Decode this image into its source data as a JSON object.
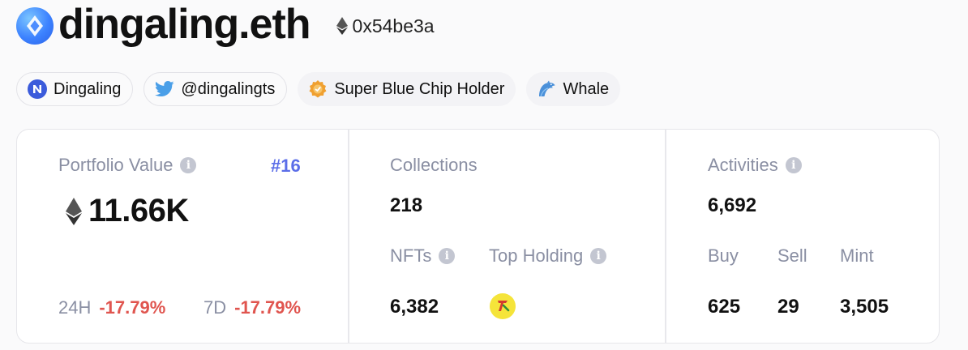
{
  "profile": {
    "name": "dingaling.eth",
    "address": "0x54be3a"
  },
  "tags": [
    {
      "label": "Dingaling",
      "icon": "nansen-icon"
    },
    {
      "label": "@dingalingts",
      "icon": "twitter-icon"
    },
    {
      "label": "Super Blue Chip Holder",
      "icon": "blue-chip-icon"
    },
    {
      "label": "Whale",
      "icon": "whale-icon"
    }
  ],
  "portfolio": {
    "label": "Portfolio Value",
    "rank": "#16",
    "value": "11.66K",
    "change_24h_label": "24H",
    "change_24h": "-17.79%",
    "change_7d_label": "7D",
    "change_7d": "-17.79%"
  },
  "collections": {
    "label": "Collections",
    "value": "218",
    "nfts_label": "NFTs",
    "nfts_value": "6,382",
    "top_holding_label": "Top Holding"
  },
  "activities": {
    "label": "Activities",
    "value": "6,692",
    "buy_label": "Buy",
    "buy_value": "625",
    "sell_label": "Sell",
    "sell_value": "29",
    "mint_label": "Mint",
    "mint_value": "3,505"
  },
  "colors": {
    "accent": "#5b6ee8",
    "negative": "#e0554f",
    "muted_text": "#8a8fa3",
    "twitter": "#4a9fe8",
    "chip": "#f0a030"
  }
}
